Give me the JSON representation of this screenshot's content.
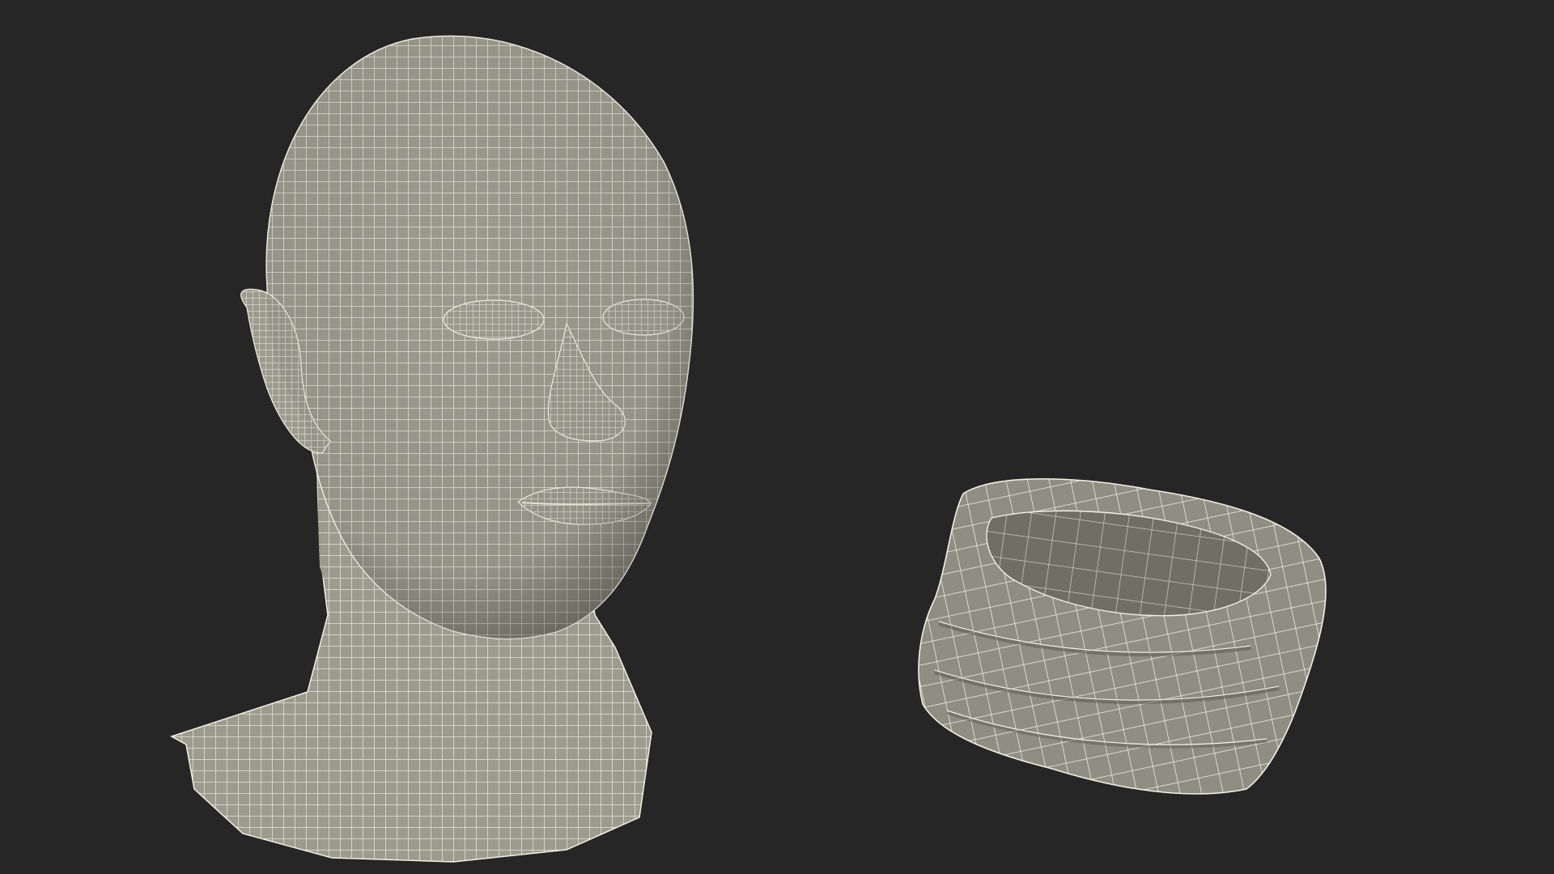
{
  "viewport": {
    "background_color": "#262626",
    "mesh_fill_color": "#9a9a8c",
    "mesh_shade_color": "#6e6e64",
    "wire_color": "#f2f0e4",
    "wire_icon": "wireframe-mesh"
  },
  "objects": [
    {
      "id": "head",
      "label_visible": false,
      "icon": "head-bust-wireframe"
    },
    {
      "id": "neck-gaiter",
      "label_visible": false,
      "icon": "neck-gaiter-wireframe"
    }
  ]
}
